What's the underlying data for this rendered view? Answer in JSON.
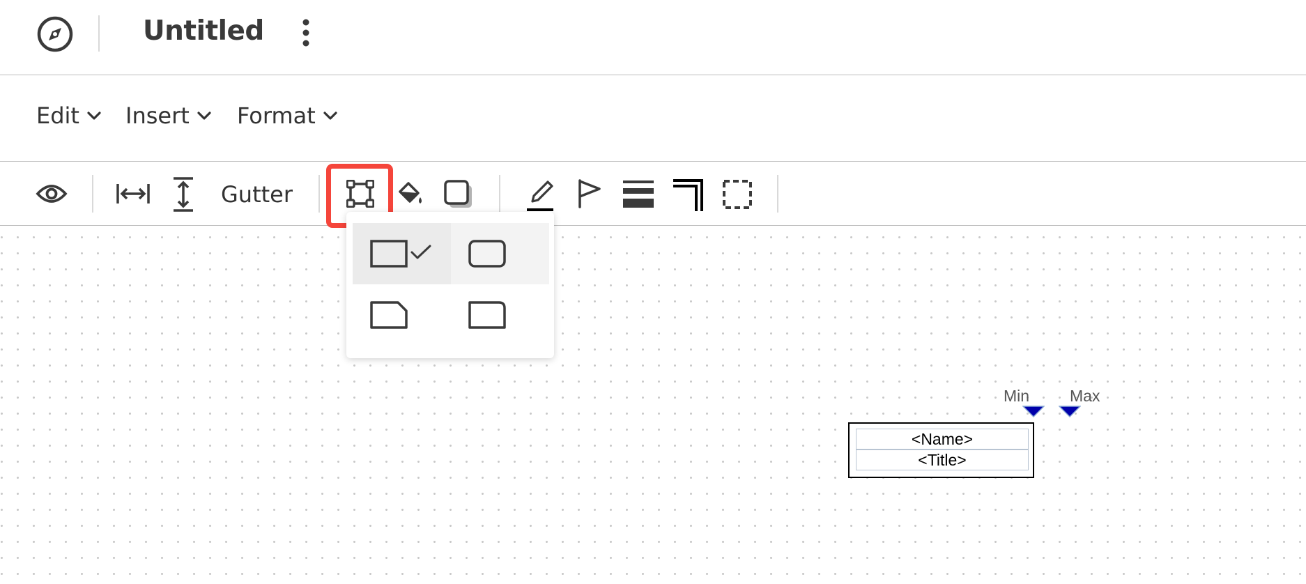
{
  "app": {
    "title": "Untitled",
    "logo_icon": "compass-icon",
    "more_icon": "more-vertical-icon"
  },
  "menus": [
    {
      "label": "Edit"
    },
    {
      "label": "Insert"
    },
    {
      "label": "Format"
    }
  ],
  "toolbar": {
    "gutter_label": "Gutter",
    "icons": [
      "eye-icon",
      "width-icon",
      "height-icon",
      "shape-outline-icon",
      "fill-bucket-icon",
      "shadow-icon",
      "pen-icon",
      "flag-icon",
      "line-weight-icon",
      "corner-icon",
      "dashed-border-icon"
    ],
    "highlight_color": "#f5453b"
  },
  "shape_popup": {
    "options": [
      {
        "name": "rectangle",
        "selected": true
      },
      {
        "name": "rounded-rectangle",
        "selected": false
      },
      {
        "name": "cut-corner-rectangle",
        "selected": false
      },
      {
        "name": "rounded-corner-rectangle",
        "selected": false
      }
    ]
  },
  "canvas": {
    "org_node": {
      "name": "<Name>",
      "title": "<Title>"
    },
    "markers": {
      "min_label": "Min",
      "max_label": "Max",
      "color": "#0000aa"
    }
  }
}
